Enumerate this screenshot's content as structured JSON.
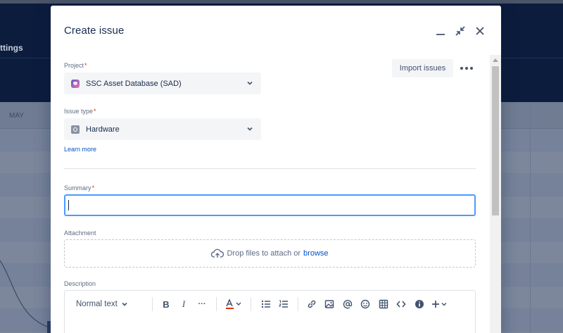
{
  "background": {
    "settings_label": "ttings",
    "month_label": "MAY"
  },
  "modal": {
    "title": "Create issue",
    "header_buttons": [
      "minimize-icon",
      "collapse-icon",
      "close-icon"
    ],
    "import_label": "Import issues",
    "fields": {
      "project": {
        "label": "Project",
        "required_mark": "*",
        "value": "SSC Asset Database (SAD)"
      },
      "issue_type": {
        "label": "Issue type",
        "required_mark": "*",
        "value": "Hardware",
        "learn_more": "Learn more"
      },
      "summary": {
        "label": "Summary",
        "required_mark": "*",
        "value": ""
      },
      "attachment": {
        "label": "Attachment",
        "drop_text": "Drop files to attach or",
        "browse_text": "browse"
      },
      "description": {
        "label": "Description"
      }
    },
    "editor_toolbar": {
      "text_style": "Normal text",
      "bold": "B",
      "italic": "I",
      "more": "···"
    }
  },
  "colors": {
    "accent": "#0052cc",
    "focus_border": "#4c9aff",
    "required": "#de350b",
    "dim_header": "#0b1c3d"
  }
}
